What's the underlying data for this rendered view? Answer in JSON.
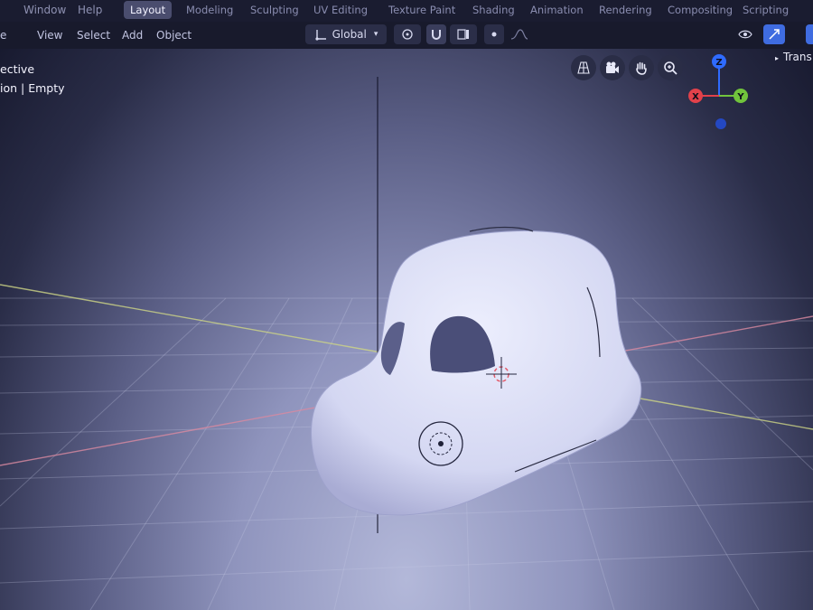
{
  "topbar": {
    "menus": [
      "Window",
      "Help"
    ],
    "workspaces": [
      {
        "label": "Layout",
        "active": true
      },
      {
        "label": "Modeling",
        "active": false
      },
      {
        "label": "Sculpting",
        "active": false
      },
      {
        "label": "UV Editing",
        "active": false
      },
      {
        "label": "Texture Paint",
        "active": false
      },
      {
        "label": "Shading",
        "active": false
      },
      {
        "label": "Animation",
        "active": false
      },
      {
        "label": "Rendering",
        "active": false
      },
      {
        "label": "Compositing",
        "active": false
      },
      {
        "label": "Scripting",
        "active": false
      }
    ]
  },
  "header": {
    "mode_fragment": "e",
    "menus": [
      "View",
      "Select",
      "Add",
      "Object"
    ],
    "orientation": "Global"
  },
  "overlay": {
    "view_type": "ective",
    "collection_info": "ion | Empty"
  },
  "sidebar": {
    "panel_label": "Trans"
  },
  "gizmo": {
    "axes": [
      "X",
      "Y",
      "Z"
    ],
    "colors": {
      "x": "#e2414a",
      "y": "#71c43c",
      "z": "#2f6bff"
    }
  },
  "colors": {
    "active_tab": "#4a4d6e",
    "x_axis_line": "#d07a8c",
    "y_axis_line": "#c9d07a",
    "model": "#d9dcf4"
  }
}
